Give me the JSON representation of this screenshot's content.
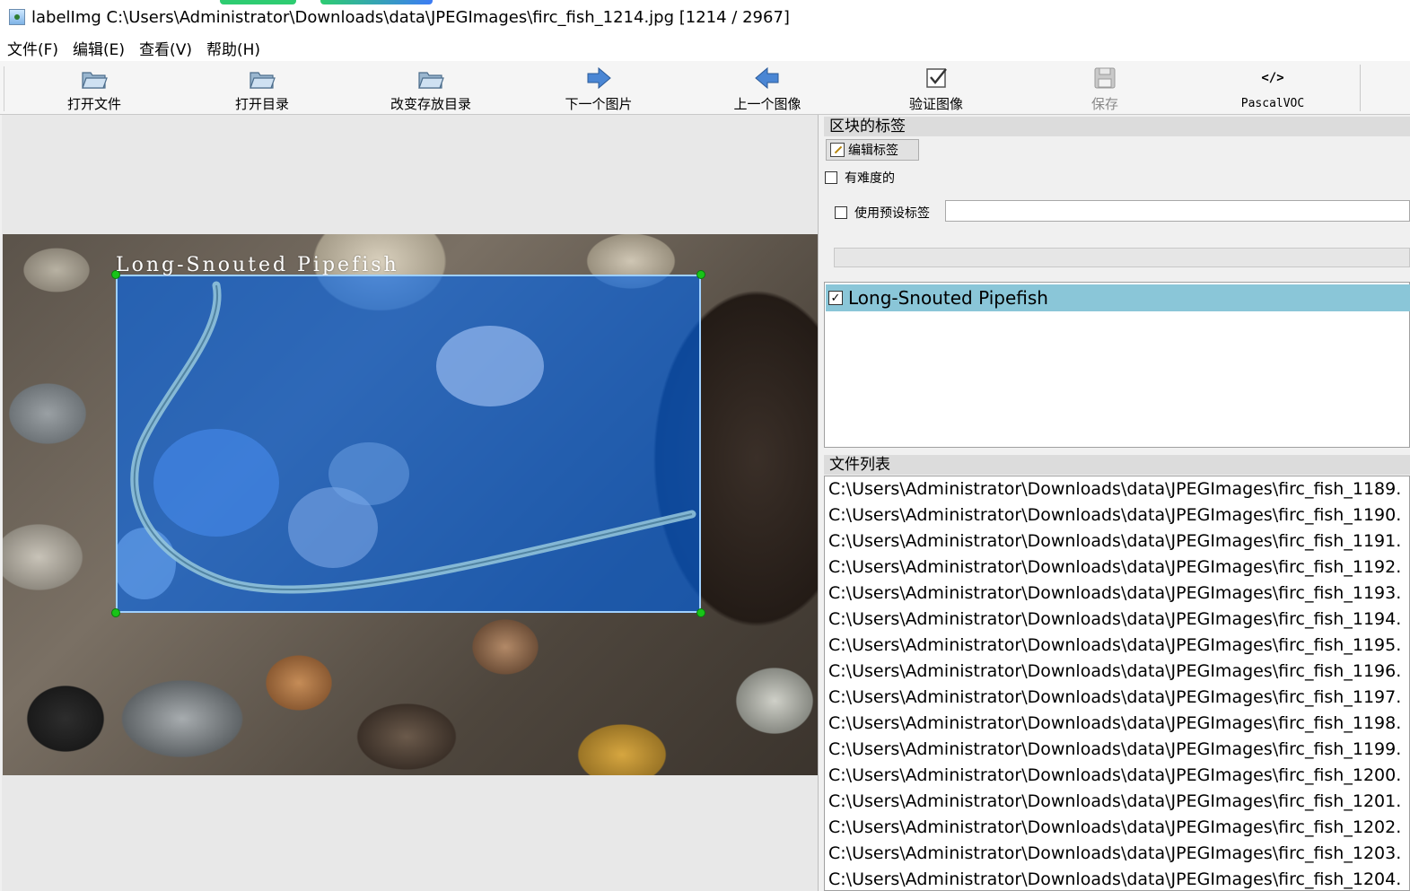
{
  "window": {
    "title": "labelImg C:\\Users\\Administrator\\Downloads\\data\\JPEGImages\\firc_fish_1214.jpg [1214 / 2967]"
  },
  "menu": [
    "文件(F)",
    "编辑(E)",
    "查看(V)",
    "帮助(H)"
  ],
  "toolbar": {
    "open_file": "打开文件",
    "open_dir": "打开目录",
    "change_save_dir": "改变存放目录",
    "next_image": "下一个图片",
    "prev_image": "上一个图像",
    "verify_image": "验证图像",
    "save": "保存",
    "format": "PascalVOC",
    "format_icon_text": "</>"
  },
  "canvas": {
    "box_label": "Long-Snouted Pipefish",
    "box_color": "#0064eb"
  },
  "right_panel": {
    "labels_dock_title": "区块的标签",
    "edit_label_button": "编辑标签",
    "difficult_label": "有难度的",
    "use_default_label": "使用预设标签",
    "default_label_value": "",
    "label_items": [
      "Long-Snouted Pipefish"
    ],
    "file_list_title": "文件列表",
    "files": [
      "C:\\Users\\Administrator\\Downloads\\data\\JPEGImages\\firc_fish_1189.",
      "C:\\Users\\Administrator\\Downloads\\data\\JPEGImages\\firc_fish_1190.",
      "C:\\Users\\Administrator\\Downloads\\data\\JPEGImages\\firc_fish_1191.",
      "C:\\Users\\Administrator\\Downloads\\data\\JPEGImages\\firc_fish_1192.",
      "C:\\Users\\Administrator\\Downloads\\data\\JPEGImages\\firc_fish_1193.",
      "C:\\Users\\Administrator\\Downloads\\data\\JPEGImages\\firc_fish_1194.",
      "C:\\Users\\Administrator\\Downloads\\data\\JPEGImages\\firc_fish_1195.",
      "C:\\Users\\Administrator\\Downloads\\data\\JPEGImages\\firc_fish_1196.",
      "C:\\Users\\Administrator\\Downloads\\data\\JPEGImages\\firc_fish_1197.",
      "C:\\Users\\Administrator\\Downloads\\data\\JPEGImages\\firc_fish_1198.",
      "C:\\Users\\Administrator\\Downloads\\data\\JPEGImages\\firc_fish_1199.",
      "C:\\Users\\Administrator\\Downloads\\data\\JPEGImages\\firc_fish_1200.",
      "C:\\Users\\Administrator\\Downloads\\data\\JPEGImages\\firc_fish_1201.",
      "C:\\Users\\Administrator\\Downloads\\data\\JPEGImages\\firc_fish_1202.",
      "C:\\Users\\Administrator\\Downloads\\data\\JPEGImages\\firc_fish_1203.",
      "C:\\Users\\Administrator\\Downloads\\data\\JPEGImages\\firc_fish_1204."
    ]
  }
}
